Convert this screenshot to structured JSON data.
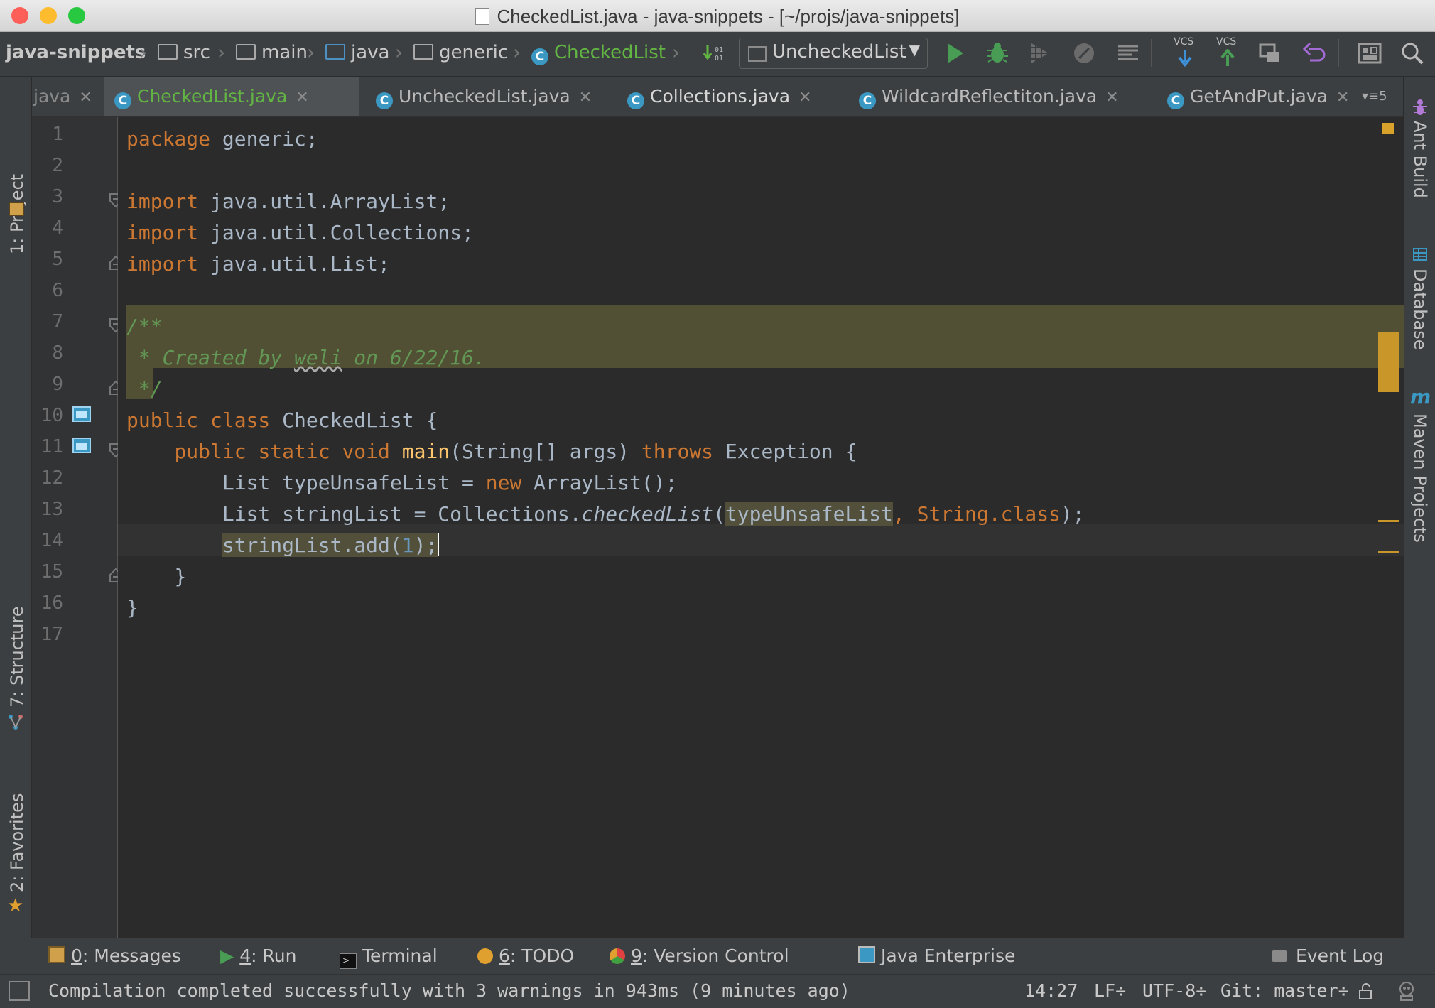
{
  "window": {
    "title": "CheckedList.java - java-snippets - [~/projs/java-snippets]"
  },
  "breadcrumb": [
    "java-snippets",
    "src",
    "main",
    "java",
    "generic",
    "CheckedList"
  ],
  "run_config": {
    "label": "UncheckedList"
  },
  "toolbar": {
    "vcs_update_label": "VCS",
    "vcs_commit_label": "VCS"
  },
  "tabs": [
    {
      "label": "java"
    },
    {
      "label": "CheckedList.java",
      "active": true
    },
    {
      "label": "UncheckedList.java"
    },
    {
      "label": "Collections.java"
    },
    {
      "label": "WildcardReflectiton.java"
    },
    {
      "label": "GetAndPut.java"
    }
  ],
  "tab_overflow": {
    "label": "5"
  },
  "left_tools": {
    "project": "1: Project",
    "structure": "7: Structure",
    "favorites": "2: Favorites"
  },
  "right_tools": {
    "ant": "Ant Build",
    "database": "Database",
    "maven": "Maven Projects"
  },
  "editor": {
    "line_numbers": [
      "1",
      "2",
      "3",
      "4",
      "5",
      "6",
      "7",
      "8",
      "9",
      "10",
      "11",
      "12",
      "13",
      "14",
      "15",
      "16",
      "17"
    ],
    "lines": {
      "l1_kw": "package",
      "l1_rest": " generic;",
      "l3_kw": "import",
      "l3_rest": " java.util.ArrayList;",
      "l4_kw": "import",
      "l4_rest": " java.util.Collections;",
      "l5_kw": "import",
      "l5_rest": " java.util.List;",
      "l7": "/**",
      "l8_a": " * Created by ",
      "l8_b": "weli",
      "l8_c": " on 6/22/16.",
      "l9": " */",
      "l10_kw": "public class",
      "l10_rest": " CheckedList {",
      "l11_kw1": "public static void",
      "l11_fn": " main",
      "l11_mid": "(String[] args) ",
      "l11_kw2": "throws",
      "l11_end": " Exception {",
      "l12_a": "List typeUnsafeList = ",
      "l12_kw": "new",
      "l12_b": " ArrayList();",
      "l13_a": "List stringList = Collections.",
      "l13_it": "checkedList",
      "l13_b": "(",
      "l13_hl": "typeUnsafeList",
      "l13_c": ", String.",
      "l13_kw": "class",
      "l13_d": ");",
      "l14_hl": "stringList.add(",
      "l14_num": "1",
      "l14_hl2": ");",
      "l15": "}",
      "l16": "}"
    }
  },
  "bottom_tools": [
    {
      "key": "0",
      "label": ": Messages"
    },
    {
      "key": "4",
      "label": ": Run"
    },
    {
      "key": "",
      "label": "Terminal"
    },
    {
      "key": "6",
      "label": ": TODO"
    },
    {
      "key": "9",
      "label": ": Version Control"
    },
    {
      "key": "",
      "label": "Java Enterprise"
    },
    {
      "key": "",
      "label": "Event Log"
    }
  ],
  "status": {
    "message": "Compilation completed successfully with 3 warnings in 943ms (9 minutes ago)",
    "position": "14:27",
    "line_sep": "LF÷",
    "encoding": "UTF-8÷",
    "vcs": "Git: master÷"
  },
  "colors": {
    "keyword": "#cc7832",
    "comment": "#629755",
    "function": "#ffc66d",
    "number": "#6897bb",
    "text": "#a9b7c6",
    "run_green": "#499c54"
  }
}
